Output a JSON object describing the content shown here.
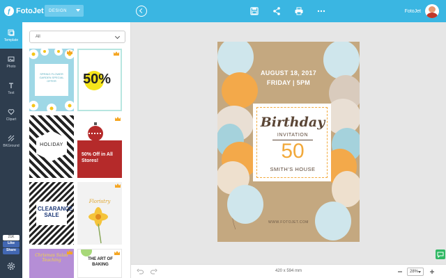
{
  "app": {
    "logo_text": "FotoJet",
    "mode": "DESIGN"
  },
  "user": {
    "name": "FotoJet"
  },
  "toolbar": {
    "icons": [
      "back-icon",
      "save-icon",
      "share-icon",
      "print-icon",
      "more-icon"
    ]
  },
  "sidebar": {
    "items": [
      {
        "label": "Template"
      },
      {
        "label": "Photo"
      },
      {
        "label": "Text"
      },
      {
        "label": "Clipart"
      },
      {
        "label": "BKGround"
      }
    ],
    "fb_count": "21K",
    "fb_like": "Like",
    "fb_share": "Share"
  },
  "panel": {
    "filter_value": "All",
    "templates": [
      {
        "text": "SPRING FLOWER GARDEN SPECIAL OFFER"
      },
      {
        "text": "50%"
      },
      {
        "text": "HOLIDAY"
      },
      {
        "text": "50% Off in All Stores!"
      },
      {
        "text": "CLEARANCE SALE"
      },
      {
        "text": "Floristry"
      },
      {
        "text": "Chrismas Salad Teaching"
      },
      {
        "text": "THE ART OF BAKING"
      }
    ]
  },
  "poster": {
    "date": "AUGUST 18, 2017",
    "time": "FRIDAY  |  5PM",
    "title": "Birthday",
    "subtitle": "INVITATION",
    "age": "50",
    "venue": "SMITH'S HOUSE",
    "website": "WWW.FOTOJET.COM"
  },
  "bottom": {
    "size": "420 x 594 mm",
    "zoom": "28%"
  },
  "colors": {
    "accent": "#3ab6e2",
    "sidebar": "#2e3d4e",
    "orange": "#f2a93b",
    "poster_bg": "#c4a880"
  }
}
